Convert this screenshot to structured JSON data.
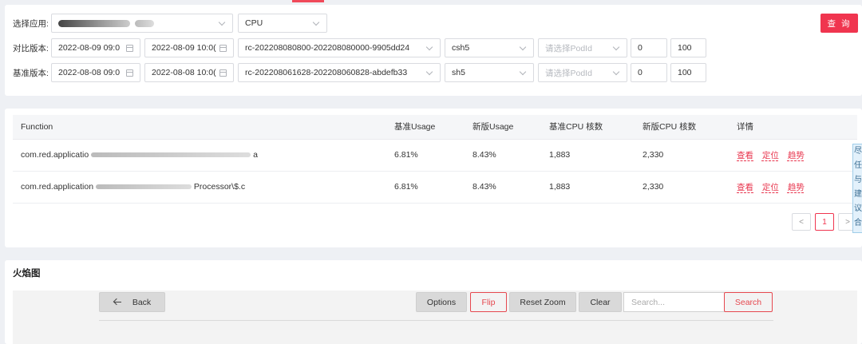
{
  "filters": {
    "app_label": "选择应用:",
    "metric": "CPU",
    "compare_label": "对比版本:",
    "base_label": "基准版本:",
    "query_button": "查 询",
    "compare": {
      "start": "2022-08-09 09:0",
      "end": "2022-08-09 10:0(",
      "version": "rc-202208080800-202208080000-9905dd24",
      "cluster": "csh5",
      "pod_placeholder": "请选择PodId",
      "min": "0",
      "max": "100"
    },
    "base": {
      "start": "2022-08-08 09:0",
      "end": "2022-08-08 10:0(",
      "version": "rc-202208061628-202208060828-abdefb33",
      "cluster": "sh5",
      "pod_placeholder": "请选择PodId",
      "min": "0",
      "max": "100"
    }
  },
  "table": {
    "columns": [
      "Function",
      "基准Usage",
      "新版Usage",
      "基准CPU 核数",
      "新版CPU 核数",
      "详情"
    ],
    "rows": [
      {
        "function": "com.red.applicatio",
        "function_tail": "a",
        "base_usage": "6.81%",
        "new_usage": "8.43%",
        "base_cores": "1,883",
        "new_cores": "2,330"
      },
      {
        "function": "com.red.application",
        "function_tail": "Processor\\$.c",
        "base_usage": "6.81%",
        "new_usage": "8.43%",
        "base_cores": "1,883",
        "new_cores": "2,330"
      }
    ],
    "actions": [
      "查看",
      "定位",
      "趋势"
    ],
    "pagination": {
      "prev": "<",
      "current": "1",
      "next": ">"
    },
    "tooltip_text": "尽 任 与 建 议 合"
  },
  "flame": {
    "title": "火焰图",
    "back": "Back",
    "options": "Options",
    "flip": "Flip",
    "reset_zoom": "Reset Zoom",
    "clear": "Clear",
    "search_placeholder": "Search...",
    "search": "Search"
  },
  "colors": {
    "accent": "#f0354f",
    "link": "#e8374f",
    "flip_border": "#e6484f"
  }
}
